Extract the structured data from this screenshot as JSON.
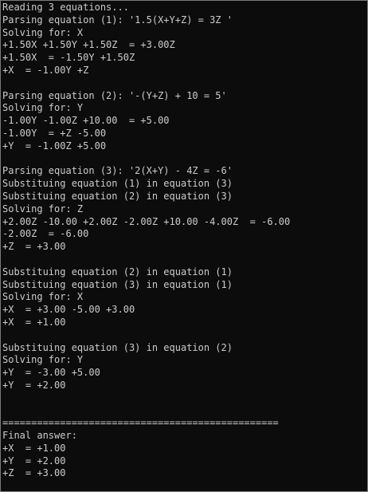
{
  "console": {
    "background_color": "#0c0c0c",
    "text_color": "#cccccc",
    "lines": [
      "Reading 3 equations...",
      "Parsing equation (1): '1.5(X+Y+Z) = 3Z '",
      "Solving for: X",
      "+1.50X +1.50Y +1.50Z  = +3.00Z",
      "+1.50X  = -1.50Y +1.50Z",
      "+X  = -1.00Y +Z",
      "",
      "Parsing equation (2): '-(Y+Z) + 10 = 5'",
      "Solving for: Y",
      "-1.00Y -1.00Z +10.00  = +5.00",
      "-1.00Y  = +Z -5.00",
      "+Y  = -1.00Z +5.00",
      "",
      "Parsing equation (3): '2(X+Y) - 4Z = -6'",
      "Substituing equation (1) in equation (3)",
      "Substituing equation (2) in equation (3)",
      "Solving for: Z",
      "+2.00Z -10.00 +2.00Z -2.00Z +10.00 -4.00Z  = -6.00",
      "-2.00Z  = -6.00",
      "+Z  = +3.00",
      "",
      "Substituing equation (2) in equation (1)",
      "Substituing equation (3) in equation (1)",
      "Solving for: X",
      "+X  = +3.00 -5.00 +3.00",
      "+X  = +1.00",
      "",
      "Substituing equation (3) in equation (2)",
      "Solving for: Y",
      "+Y  = -3.00 +5.00",
      "+Y  = +2.00",
      "",
      "",
      "================================================",
      "Final answer:",
      "+X  = +1.00",
      "+Y  = +2.00",
      "+Z  = +3.00"
    ]
  }
}
